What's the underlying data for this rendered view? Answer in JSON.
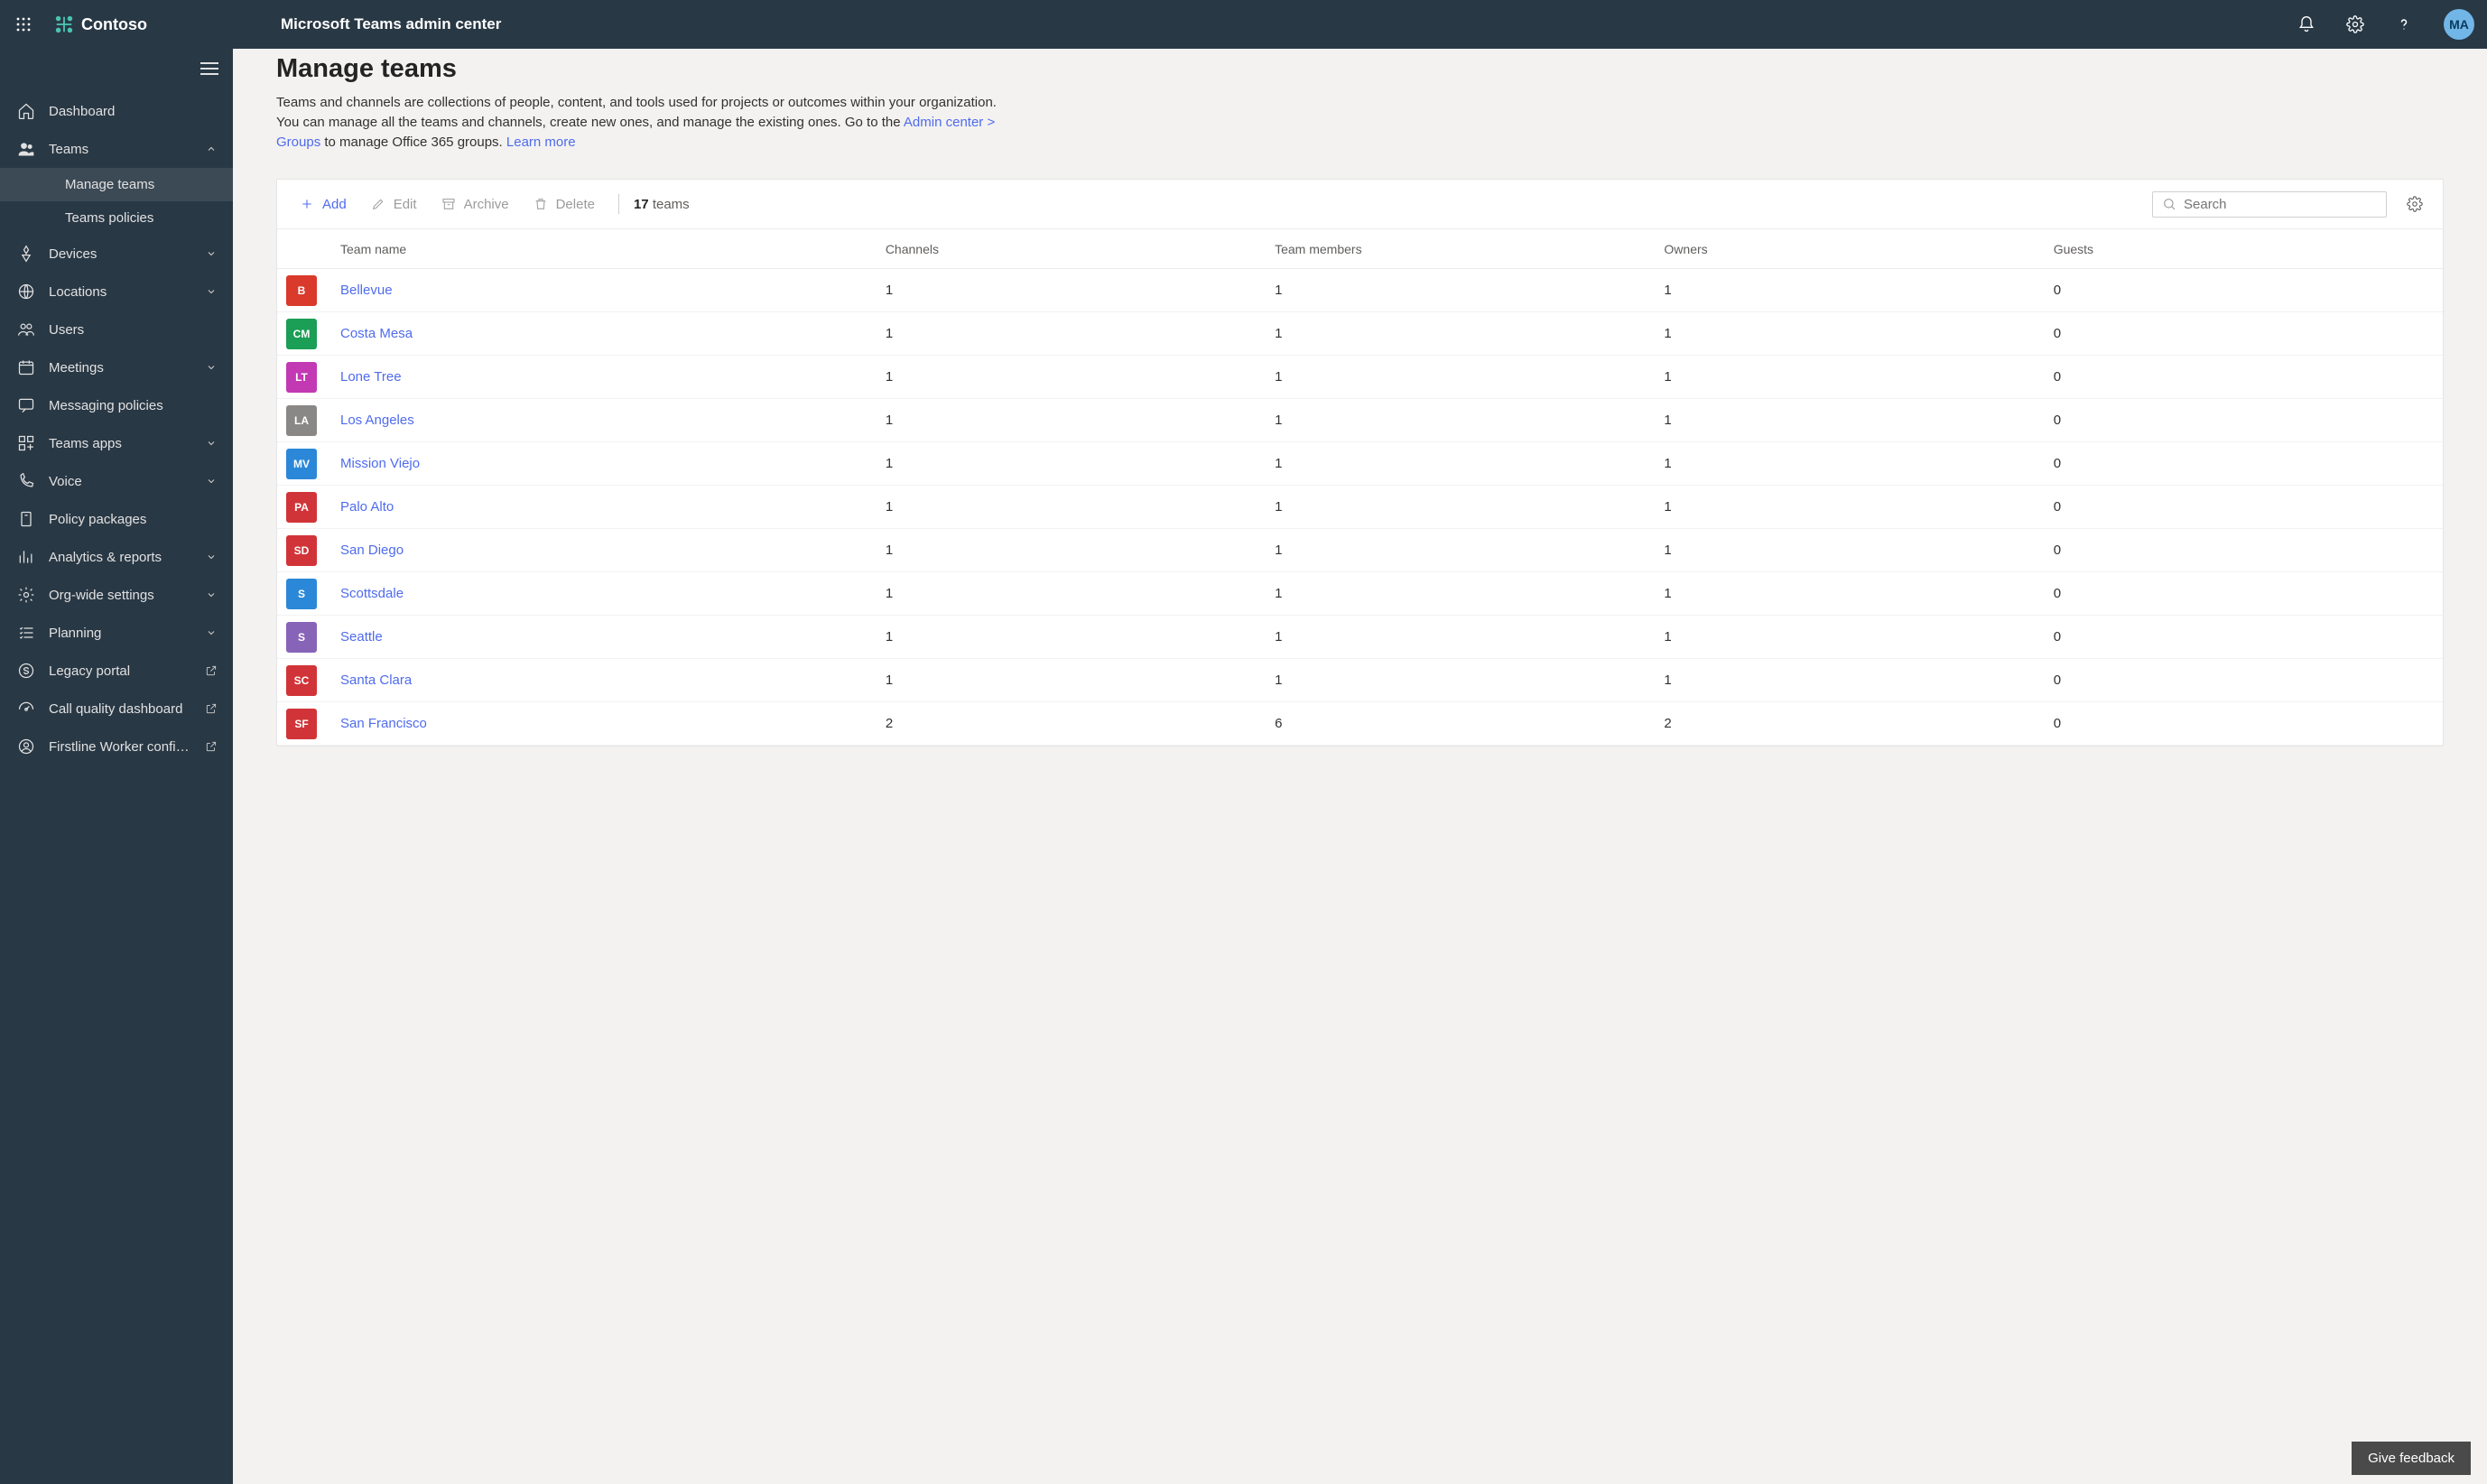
{
  "header": {
    "brand": "Contoso",
    "title": "Microsoft Teams admin center",
    "avatar_initials": "MA"
  },
  "sidebar": {
    "items": [
      {
        "id": "dashboard",
        "label": "Dashboard",
        "icon": "home",
        "expandable": false
      },
      {
        "id": "teams",
        "label": "Teams",
        "icon": "people",
        "expandable": true,
        "expanded": true,
        "children": [
          {
            "id": "manage-teams",
            "label": "Manage teams",
            "active": true
          },
          {
            "id": "teams-policies",
            "label": "Teams policies"
          }
        ]
      },
      {
        "id": "devices",
        "label": "Devices",
        "icon": "device",
        "expandable": true
      },
      {
        "id": "locations",
        "label": "Locations",
        "icon": "globe",
        "expandable": true
      },
      {
        "id": "users",
        "label": "Users",
        "icon": "users",
        "expandable": false
      },
      {
        "id": "meetings",
        "label": "Meetings",
        "icon": "calendar",
        "expandable": true
      },
      {
        "id": "messaging-policies",
        "label": "Messaging policies",
        "icon": "chat",
        "expandable": false
      },
      {
        "id": "teams-apps",
        "label": "Teams apps",
        "icon": "apps",
        "expandable": true
      },
      {
        "id": "voice",
        "label": "Voice",
        "icon": "phone",
        "expandable": true
      },
      {
        "id": "policy-packages",
        "label": "Policy packages",
        "icon": "package",
        "expandable": false
      },
      {
        "id": "analytics",
        "label": "Analytics & reports",
        "icon": "chart",
        "expandable": true
      },
      {
        "id": "org-settings",
        "label": "Org-wide settings",
        "icon": "gear",
        "expandable": true
      },
      {
        "id": "planning",
        "label": "Planning",
        "icon": "checklist",
        "expandable": true
      },
      {
        "id": "legacy-portal",
        "label": "Legacy portal",
        "icon": "skype",
        "external": true
      },
      {
        "id": "call-quality",
        "label": "Call quality dashboard",
        "icon": "dashboard",
        "external": true
      },
      {
        "id": "firstline",
        "label": "Firstline Worker configu...",
        "icon": "worker",
        "external": true
      }
    ]
  },
  "page": {
    "title": "Manage teams",
    "desc_pre": "Teams and channels are collections of people, content, and tools used for projects or outcomes within your organization. You can manage all the teams and channels, create new ones, and manage the existing ones. Go to the ",
    "desc_link": "Admin center > Groups",
    "desc_mid": " to manage Office 365 groups. ",
    "learn_more": "Learn more"
  },
  "toolbar": {
    "add": "Add",
    "edit": "Edit",
    "archive": "Archive",
    "delete": "Delete",
    "count_number": "17",
    "count_label": "teams",
    "search_placeholder": "Search"
  },
  "table": {
    "headers": {
      "name": "Team name",
      "channels": "Channels",
      "members": "Team members",
      "owners": "Owners",
      "guests": "Guests"
    },
    "rows": [
      {
        "initials": "B",
        "color": "#d93a2b",
        "name": "Bellevue",
        "channels": "1",
        "members": "1",
        "owners": "1",
        "guests": "0"
      },
      {
        "initials": "CM",
        "color": "#1b9e55",
        "name": "Costa Mesa",
        "channels": "1",
        "members": "1",
        "owners": "1",
        "guests": "0"
      },
      {
        "initials": "LT",
        "color": "#c239b3",
        "name": "Lone Tree",
        "channels": "1",
        "members": "1",
        "owners": "1",
        "guests": "0"
      },
      {
        "initials": "LA",
        "color": "#8a8886",
        "name": "Los Angeles",
        "channels": "1",
        "members": "1",
        "owners": "1",
        "guests": "0"
      },
      {
        "initials": "MV",
        "color": "#2b88d8",
        "name": "Mission Viejo",
        "channels": "1",
        "members": "1",
        "owners": "1",
        "guests": "0"
      },
      {
        "initials": "PA",
        "color": "#d13438",
        "name": "Palo Alto",
        "channels": "1",
        "members": "1",
        "owners": "1",
        "guests": "0"
      },
      {
        "initials": "SD",
        "color": "#d13438",
        "name": "San Diego",
        "channels": "1",
        "members": "1",
        "owners": "1",
        "guests": "0"
      },
      {
        "initials": "S",
        "color": "#2b88d8",
        "name": "Scottsdale",
        "channels": "1",
        "members": "1",
        "owners": "1",
        "guests": "0"
      },
      {
        "initials": "S",
        "color": "#8764b8",
        "name": "Seattle",
        "channels": "1",
        "members": "1",
        "owners": "1",
        "guests": "0"
      },
      {
        "initials": "SC",
        "color": "#d13438",
        "name": "Santa Clara",
        "channels": "1",
        "members": "1",
        "owners": "1",
        "guests": "0"
      },
      {
        "initials": "SF",
        "color": "#d13438",
        "name": "San Francisco",
        "channels": "2",
        "members": "6",
        "owners": "2",
        "guests": "0"
      }
    ]
  },
  "feedback": {
    "label": "Give feedback"
  }
}
